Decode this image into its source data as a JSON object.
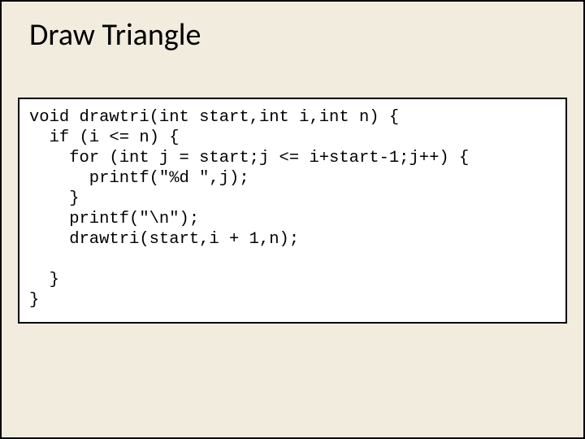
{
  "title": "Draw Triangle",
  "code": "void drawtri(int start,int i,int n) {\n  if (i <= n) {\n    for (int j = start;j <= i+start-1;j++) {\n      printf(\"%d \",j);\n    }\n    printf(\"\\n\");\n    drawtri(start,i + 1,n);\n\n  }\n}"
}
